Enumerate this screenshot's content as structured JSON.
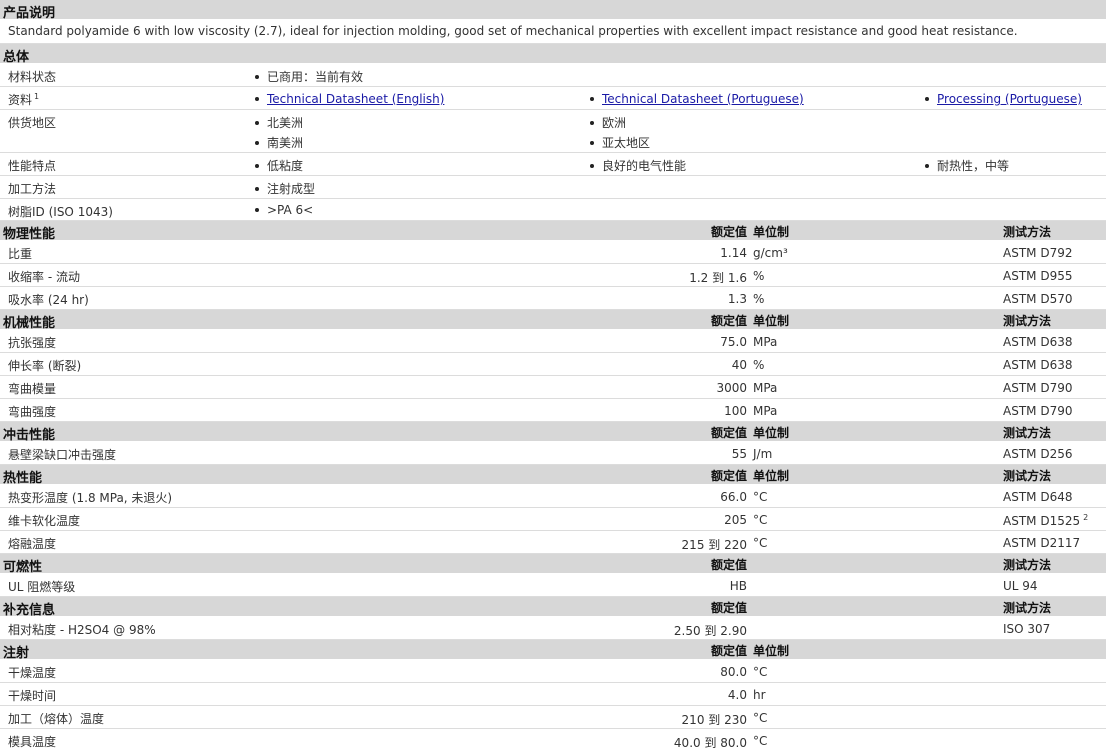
{
  "product": {
    "header": "产品说明",
    "description": "Standard polyamide 6 with low viscosity (2.7), ideal for injection molding, good set of mechanical properties with excellent impact resistance and good heat resistance."
  },
  "general": {
    "header": "总体",
    "rows": {
      "status": {
        "label": "材料状态",
        "items": [
          "已商用：当前有效"
        ]
      },
      "docs": {
        "label": "资料",
        "sup": "1",
        "links": [
          "Technical Datasheet (English)",
          "Technical Datasheet (Portuguese)",
          "Processing (Portuguese)"
        ]
      },
      "region": {
        "label": "供货地区",
        "items": [
          "北美洲",
          "欧洲",
          "南美洲",
          "亚太地区"
        ]
      },
      "features": {
        "label": "性能特点",
        "items": [
          "低粘度",
          "良好的电气性能",
          "耐热性，中等"
        ]
      },
      "processing": {
        "label": "加工方法",
        "items": [
          "注射成型"
        ]
      },
      "resin_id": {
        "label": "树脂ID (ISO 1043)",
        "items": [
          ">PA 6<"
        ]
      }
    }
  },
  "columns": {
    "value": "额定值",
    "unit": "单位制",
    "test": "测试方法"
  },
  "physical": {
    "header": "物理性能",
    "rows": [
      {
        "label": "比重",
        "value": "1.14",
        "unit": "g/cm³",
        "test": "ASTM D792"
      },
      {
        "label": "收缩率 - 流动",
        "value": "1.2 到  1.6",
        "unit": "%",
        "test": "ASTM D955"
      },
      {
        "label": "吸水率 (24 hr)",
        "value": "1.3",
        "unit": "%",
        "test": "ASTM D570"
      }
    ]
  },
  "mechanical": {
    "header": "机械性能",
    "rows": [
      {
        "label": "抗张强度",
        "value": "75.0",
        "unit": "MPa",
        "test": "ASTM D638"
      },
      {
        "label": "伸长率 (断裂)",
        "value": "40",
        "unit": "%",
        "test": "ASTM D638"
      },
      {
        "label": "弯曲模量",
        "value": "3000",
        "unit": "MPa",
        "test": "ASTM D790"
      },
      {
        "label": "弯曲强度",
        "value": "100",
        "unit": "MPa",
        "test": "ASTM D790"
      }
    ]
  },
  "impact": {
    "header": "冲击性能",
    "rows": [
      {
        "label": "悬壁梁缺口冲击强度",
        "value": "55",
        "unit": "J/m",
        "test": "ASTM D256"
      }
    ]
  },
  "thermal": {
    "header": "热性能",
    "rows": [
      {
        "label": "热变形温度 (1.8 MPa, 未退火)",
        "value": "66.0",
        "unit": "°C",
        "test": "ASTM D648"
      },
      {
        "label": "维卡软化温度",
        "value": "205",
        "unit": "°C",
        "test": "ASTM D1525",
        "sup": "2"
      },
      {
        "label": "熔融温度",
        "value": "215 到  220",
        "unit": "°C",
        "test": "ASTM D2117"
      }
    ]
  },
  "flammability": {
    "header": "可燃性",
    "rows": [
      {
        "label": "UL 阻燃等级",
        "value": "HB",
        "unit": "",
        "test": "UL 94"
      }
    ]
  },
  "additional": {
    "header": "补充信息",
    "rows": [
      {
        "label": "相对粘度 - H2SO4 @ 98%",
        "value": "2.50 到  2.90",
        "unit": "",
        "test": "ISO 307"
      }
    ]
  },
  "injection": {
    "header": "注射",
    "rows": [
      {
        "label": "干燥温度",
        "value": "80.0",
        "unit": "°C",
        "test": ""
      },
      {
        "label": "干燥时间",
        "value": "4.0",
        "unit": "hr",
        "test": ""
      },
      {
        "label": "加工（熔体）温度",
        "value": "210 到  230",
        "unit": "°C",
        "test": ""
      },
      {
        "label": "模具温度",
        "value": "40.0 到  80.0",
        "unit": "°C",
        "test": ""
      }
    ]
  }
}
